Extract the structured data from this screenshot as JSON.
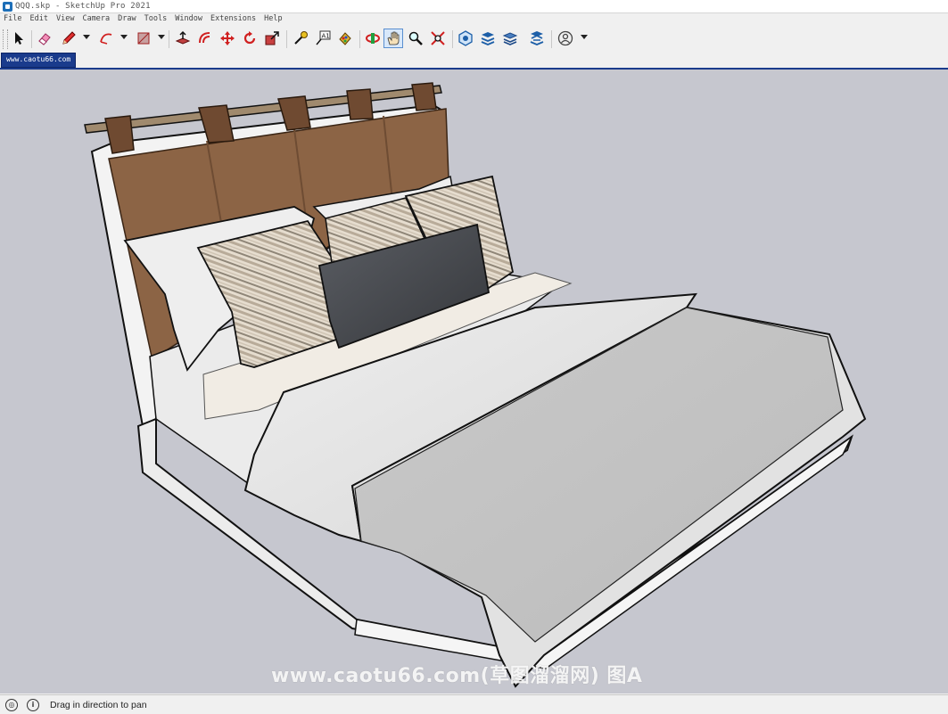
{
  "window": {
    "title": "QQQ.skp - SketchUp Pro 2021"
  },
  "menu": [
    "File",
    "Edit",
    "View",
    "Camera",
    "Draw",
    "Tools",
    "Window",
    "Extensions",
    "Help"
  ],
  "toolbar": {
    "tools": [
      {
        "name": "select-tool",
        "icon": "arrow-cursor-icon"
      },
      {
        "name": "eraser-tool",
        "icon": "eraser-icon"
      },
      {
        "name": "line-tool",
        "icon": "pencil-icon"
      },
      {
        "name": "arc-tool",
        "icon": "arc-icon"
      },
      {
        "name": "rectangle-tool",
        "icon": "rectangle-icon"
      },
      {
        "name": "push-pull-tool",
        "icon": "push-pull-icon"
      },
      {
        "name": "offset-tool",
        "icon": "offset-icon"
      },
      {
        "name": "move-tool",
        "icon": "move-icon"
      },
      {
        "name": "rotate-tool",
        "icon": "rotate-icon"
      },
      {
        "name": "scale-tool",
        "icon": "scale-icon"
      },
      {
        "name": "tape-measure-tool",
        "icon": "tape-measure-icon"
      },
      {
        "name": "text-tool",
        "icon": "text-icon"
      },
      {
        "name": "paint-bucket-tool",
        "icon": "paint-bucket-icon"
      },
      {
        "name": "orbit-tool",
        "icon": "orbit-icon"
      },
      {
        "name": "pan-tool",
        "icon": "pan-hand-icon",
        "active": true
      },
      {
        "name": "zoom-tool",
        "icon": "zoom-icon"
      },
      {
        "name": "zoom-extents-tool",
        "icon": "zoom-extents-icon"
      },
      {
        "name": "3d-warehouse-button",
        "icon": "warehouse-icon"
      },
      {
        "name": "extension-warehouse-button",
        "icon": "extension-warehouse-icon"
      },
      {
        "name": "layout-button",
        "icon": "layout-icon"
      },
      {
        "name": "extension-manager-button",
        "icon": "extension-manager-icon"
      },
      {
        "name": "account-button",
        "icon": "user-icon"
      }
    ]
  },
  "scene_tab": {
    "label": "www.caotu66.com"
  },
  "watermark": "www.caotu66.com(草图溜溜网) 图A",
  "status": {
    "message": "Drag in direction to pan"
  },
  "colors": {
    "accent": "#1a3b8c",
    "viewport_bg": "#c6c7cf",
    "headboard": "#8c6445",
    "strap": "#6f4a31",
    "frame": "#f4f4f4"
  }
}
